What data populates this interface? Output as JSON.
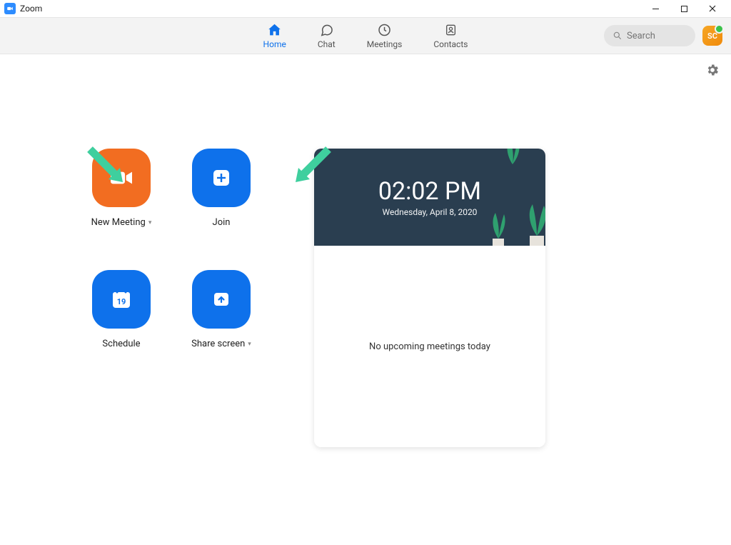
{
  "window": {
    "title": "Zoom"
  },
  "nav": {
    "items": [
      {
        "label": "Home",
        "active": true
      },
      {
        "label": "Chat"
      },
      {
        "label": "Meetings"
      },
      {
        "label": "Contacts"
      }
    ],
    "search_placeholder": "Search",
    "avatar_initials": "SC"
  },
  "actions": {
    "new_meeting": "New Meeting",
    "join": "Join",
    "schedule": "Schedule",
    "share_screen": "Share screen",
    "calendar_day": "19"
  },
  "panel": {
    "time": "02:02 PM",
    "date": "Wednesday, April 8, 2020",
    "message": "No upcoming meetings today"
  },
  "colors": {
    "accent_blue": "#0e71eb",
    "accent_orange": "#f26d21",
    "annotation_green": "#3fcf9e"
  }
}
